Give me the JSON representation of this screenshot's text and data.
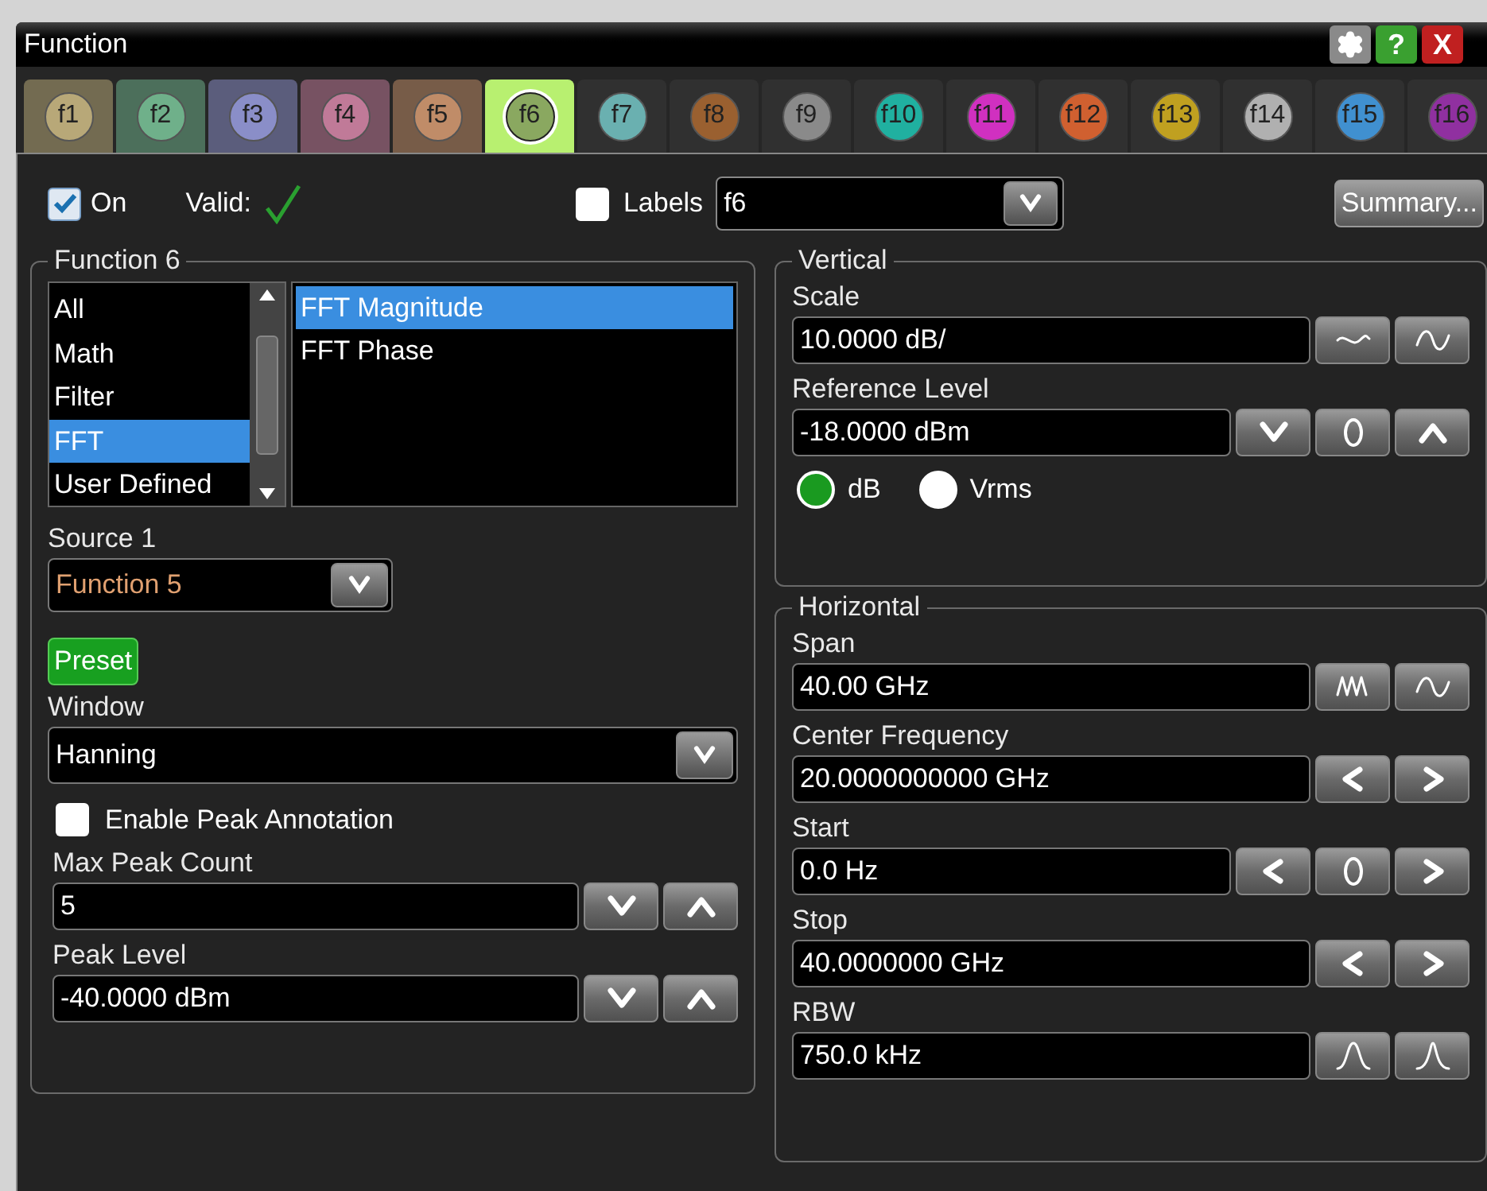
{
  "window": {
    "title": "Function",
    "title_buttons": [
      {
        "kind": "settings"
      },
      {
        "kind": "help",
        "label": "?"
      },
      {
        "kind": "close",
        "label": "X"
      }
    ]
  },
  "tabs": [
    {
      "label": "f1",
      "color": "#b8a878",
      "active": true,
      "selected": false
    },
    {
      "label": "f2",
      "color": "#6fb08a",
      "active": true,
      "selected": false
    },
    {
      "label": "f3",
      "color": "#8a8ec8",
      "active": true,
      "selected": false
    },
    {
      "label": "f4",
      "color": "#c07a98",
      "active": true,
      "selected": false
    },
    {
      "label": "f5",
      "color": "#c08c68",
      "active": true,
      "selected": false
    },
    {
      "label": "f6",
      "color": "#8aa860",
      "active": true,
      "selected": true
    },
    {
      "label": "f7",
      "color": "#6ab0b0",
      "active": false,
      "selected": false
    },
    {
      "label": "f8",
      "color": "#9a6030",
      "active": false,
      "selected": false
    },
    {
      "label": "f9",
      "color": "#8a8a8a",
      "active": false,
      "selected": false
    },
    {
      "label": "f10",
      "color": "#20b0a0",
      "active": false,
      "selected": false
    },
    {
      "label": "f11",
      "color": "#d030c0",
      "active": false,
      "selected": false
    },
    {
      "label": "f12",
      "color": "#d06030",
      "active": false,
      "selected": false
    },
    {
      "label": "f13",
      "color": "#c0a020",
      "active": false,
      "selected": false
    },
    {
      "label": "f14",
      "color": "#b0b0b0",
      "active": false,
      "selected": false
    },
    {
      "label": "f15",
      "color": "#4090d0",
      "active": false,
      "selected": false
    },
    {
      "label": "f16",
      "color": "#9030a0",
      "active": false,
      "selected": false
    }
  ],
  "on_checkbox": {
    "label": "On",
    "checked": true
  },
  "valid": {
    "label": "Valid:",
    "ok": true
  },
  "labels_checkbox": {
    "label": "Labels",
    "checked": false
  },
  "label_select": {
    "value": "f6"
  },
  "summary_button": "Summary...",
  "function_group": {
    "title": "Function 6",
    "categories": [
      {
        "label": "All",
        "selected": false
      },
      {
        "label": "Math",
        "selected": false
      },
      {
        "label": "Filter",
        "selected": false
      },
      {
        "label": "FFT",
        "selected": true
      },
      {
        "label": "User Defined",
        "selected": false
      }
    ],
    "operations": [
      {
        "label": "FFT Magnitude",
        "selected": true
      },
      {
        "label": "FFT Phase",
        "selected": false
      }
    ],
    "source_label": "Source 1",
    "source_value": "Function 5",
    "preset_button": "Preset",
    "window_label": "Window",
    "window_value": "Hanning",
    "peak_annotation": {
      "label": "Enable Peak Annotation",
      "checked": false
    },
    "fields": [
      {
        "label": "Max Peak Count",
        "value": "5",
        "buttons": [
          {
            "kind": "down"
          },
          {
            "kind": "up"
          }
        ]
      },
      {
        "label": "Peak Level",
        "value": "-40.0000 dBm",
        "buttons": [
          {
            "kind": "down"
          },
          {
            "kind": "up"
          }
        ]
      }
    ]
  },
  "vertical": {
    "title": "Vertical",
    "fields": [
      {
        "label": "Scale",
        "value": "10.0000 dB/",
        "buttons": [
          {
            "kind": "wave-flat"
          },
          {
            "kind": "wave"
          }
        ]
      },
      {
        "label": "Reference Level",
        "value": "-18.0000 dBm",
        "buttons": [
          {
            "kind": "down"
          },
          {
            "kind": "zero"
          },
          {
            "kind": "up"
          }
        ]
      }
    ],
    "units": [
      {
        "label": "dB",
        "selected": true
      },
      {
        "label": "Vrms",
        "selected": false
      }
    ]
  },
  "horizontal": {
    "title": "Horizontal",
    "fields": [
      {
        "label": "Span",
        "value": "40.00 GHz",
        "buttons": [
          {
            "kind": "wave-dense"
          },
          {
            "kind": "wave"
          }
        ]
      },
      {
        "label": "Center Frequency",
        "value": "20.0000000000 GHz",
        "buttons": [
          {
            "kind": "left"
          },
          {
            "kind": "right"
          }
        ]
      },
      {
        "label": "Start",
        "value": "0.0 Hz",
        "buttons": [
          {
            "kind": "left"
          },
          {
            "kind": "zero"
          },
          {
            "kind": "right"
          }
        ]
      },
      {
        "label": "Stop",
        "value": "40.0000000 GHz",
        "buttons": [
          {
            "kind": "left"
          },
          {
            "kind": "right"
          }
        ]
      },
      {
        "label": "RBW",
        "value": "750.0 kHz",
        "buttons": [
          {
            "kind": "peak-wide"
          },
          {
            "kind": "peak-narrow"
          }
        ]
      }
    ]
  }
}
